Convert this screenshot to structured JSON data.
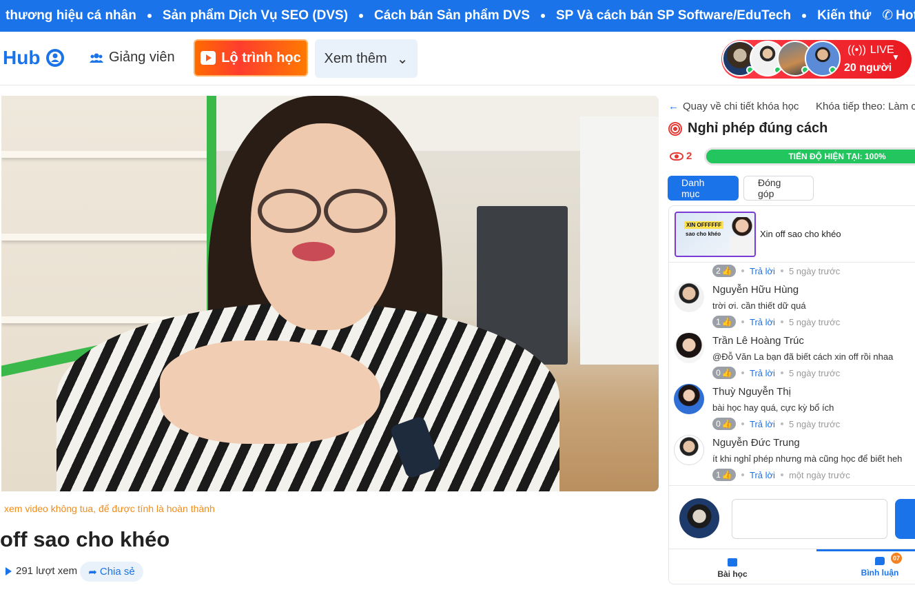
{
  "marquee": {
    "items": [
      "thương hiệu cá nhân",
      "Sản phẩm Dịch Vụ SEO (DVS)",
      "Cách bán Sản phẩm DVS",
      "SP Và cách bán SP Software/EduTech",
      "Kiến thứ"
    ],
    "hotline": "Hotlin"
  },
  "header": {
    "logo_text": "Hub",
    "instructor_label": "Giảng viên",
    "roadmap_label": "Lộ trình học",
    "more_label": "Xem thêm",
    "live_label": "LIVE",
    "live_count": "20 người"
  },
  "video": {
    "notice": "xem video không tua, để được tính là hoàn thành",
    "title": "off sao cho khéo",
    "views": "291 lượt xem",
    "share_label": "Chia sẻ"
  },
  "panel": {
    "back_label": "Quay về chi tiết khóa học",
    "next_label": "Khóa tiếp theo: Làm c",
    "lesson_title": "Nghỉ phép đúng cách",
    "view_count": "2",
    "progress_text": "TIẾN ĐỘ HIỆN TẠI: 100%",
    "progress_value": 100,
    "tabs": [
      "Danh mục",
      "Đóng góp"
    ],
    "lesson_item": {
      "title": "Xin off sao cho khéo",
      "thumb_tag": "XIN OFFFFFF",
      "thumb_sub": "sao cho khéo"
    },
    "top_meta": {
      "likes": "2",
      "reply": "Trả lời",
      "time": "5 ngày trước"
    },
    "comments": [
      {
        "name": "Nguyễn Hữu Hùng",
        "text": "trời ơi. cần thiết dữ quá",
        "likes": "1",
        "reply": "Trả lời",
        "time": "5 ngày trước"
      },
      {
        "name": "Trần Lê Hoàng Trúc",
        "text": "@Đỗ Văn La bạn đã biết cách xin off rồi nhaa",
        "likes": "0",
        "reply": "Trả lời",
        "time": "5 ngày trước"
      },
      {
        "name": "Thuỳ Nguyễn Thị",
        "text": "bài học hay quá, cực kỳ bổ ích",
        "likes": "0",
        "reply": "Trả lời",
        "time": "5 ngày trước"
      },
      {
        "name": "Nguyễn Đức Trung",
        "text": "ít khi nghỉ phép nhưng mà cũng học để biết heh",
        "likes": "1",
        "reply": "Trả lời",
        "time": "một ngày trước"
      }
    ],
    "bottom_tabs": {
      "lesson": "Bài học",
      "comments": "Bình luận",
      "comments_badge": "07"
    }
  },
  "colors": {
    "primary": "#1a73e8",
    "live": "#e8191f",
    "progress": "#22c55e",
    "notice": "#f08c1a"
  }
}
